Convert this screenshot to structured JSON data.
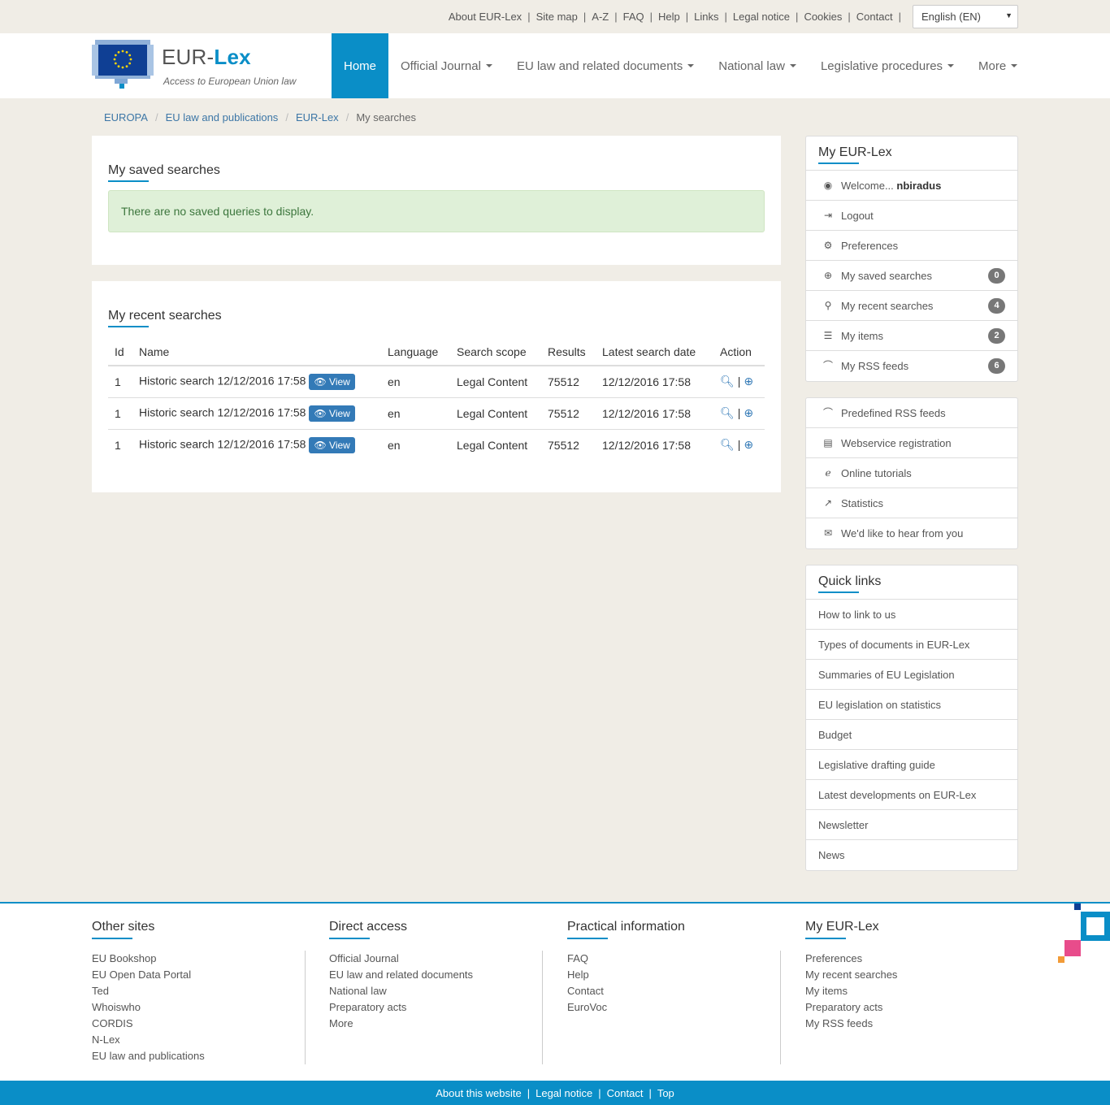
{
  "utility": {
    "links": [
      "About EUR-Lex",
      "Site map",
      "A-Z",
      "FAQ",
      "Help",
      "Links",
      "Legal notice",
      "Cookies",
      "Contact"
    ],
    "language": "English (EN)"
  },
  "header": {
    "logo_prefix": "EUR-",
    "logo_suffix": "Lex",
    "logo_subtitle": "Access to European Union law",
    "nav": [
      {
        "label": "Home",
        "active": true,
        "caret": false
      },
      {
        "label": "Official Journal",
        "caret": true
      },
      {
        "label": "EU law and related documents",
        "caret": true
      },
      {
        "label": "National law",
        "caret": true
      },
      {
        "label": "Legislative procedures",
        "caret": true
      },
      {
        "label": "More",
        "caret": true
      }
    ]
  },
  "breadcrumb": {
    "items": [
      "EUROPA",
      "EU law and publications",
      "EUR-Lex"
    ],
    "current": "My searches"
  },
  "saved": {
    "title": "My saved searches",
    "empty_message": "There are no saved queries to display."
  },
  "recent": {
    "title": "My recent searches",
    "columns": [
      "Id",
      "Name",
      "Language",
      "Search scope",
      "Results",
      "Latest search date",
      "Action"
    ],
    "view_label": "View",
    "rows": [
      {
        "id": "1",
        "name": "Historic search 12/12/2016 17:58",
        "language": "en",
        "scope": "Legal Content",
        "results": "75512",
        "date": "12/12/2016 17:58"
      },
      {
        "id": "1",
        "name": "Historic search 12/12/2016 17:58",
        "language": "en",
        "scope": "Legal Content",
        "results": "75512",
        "date": "12/12/2016 17:58"
      },
      {
        "id": "1",
        "name": "Historic search 12/12/2016 17:58",
        "language": "en",
        "scope": "Legal Content",
        "results": "75512",
        "date": "12/12/2016 17:58"
      }
    ]
  },
  "my_eurlex": {
    "title": "My EUR-Lex",
    "welcome": "Welcome...",
    "username": "nbiradus",
    "items": [
      {
        "label": "Logout",
        "icon": "logout-icon"
      },
      {
        "label": "Preferences",
        "icon": "gear-icon"
      },
      {
        "label": "My saved searches",
        "icon": "zoom-in-icon",
        "badge": "0"
      },
      {
        "label": "My recent searches",
        "icon": "search-icon",
        "badge": "4"
      },
      {
        "label": "My items",
        "icon": "list-icon",
        "badge": "2"
      },
      {
        "label": "My RSS feeds",
        "icon": "rss-icon",
        "badge": "6"
      }
    ]
  },
  "tools": {
    "items": [
      {
        "label": "Predefined RSS feeds",
        "icon": "rss-icon"
      },
      {
        "label": "Webservice registration",
        "icon": "server-icon"
      },
      {
        "label": "Online tutorials",
        "icon": "browser-icon"
      },
      {
        "label": "Statistics",
        "icon": "chart-icon"
      },
      {
        "label": "We'd like to hear from you",
        "icon": "envelope-icon"
      }
    ]
  },
  "quick_links": {
    "title": "Quick links",
    "items": [
      "How to link to us",
      "Types of documents in EUR-Lex",
      "Summaries of EU Legislation",
      "EU legislation on statistics",
      "Budget",
      "Legislative drafting guide",
      "Latest developments on EUR-Lex",
      "Newsletter",
      "News"
    ]
  },
  "footer": {
    "columns": [
      {
        "title": "Other sites",
        "items": [
          "EU Bookshop",
          "EU Open Data Portal",
          "Ted",
          "Whoiswho",
          "CORDIS",
          "N-Lex",
          "EU law and publications"
        ]
      },
      {
        "title": "Direct access",
        "items": [
          "Official Journal",
          "EU law and related documents",
          "National law",
          "Preparatory acts",
          "More"
        ]
      },
      {
        "title": "Practical information",
        "items": [
          "FAQ",
          "Help",
          "Contact",
          "EuroVoc"
        ]
      },
      {
        "title": "My EUR-Lex",
        "items": [
          "Preferences",
          "My recent searches",
          "My items",
          "Preparatory acts",
          "My RSS feeds"
        ]
      }
    ],
    "bottom_links": [
      "About this website",
      "Legal notice",
      "Contact",
      "Top"
    ]
  },
  "colors": {
    "accent": "#0a8ec7",
    "badge": "#777777",
    "alert_bg": "#dff0d8",
    "button": "#337ab7"
  }
}
